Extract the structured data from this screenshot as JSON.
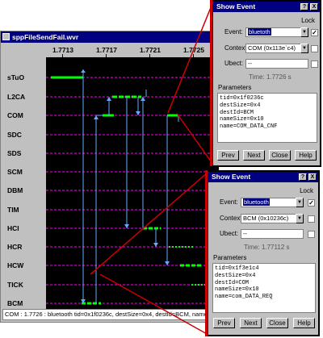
{
  "main_window": {
    "title": "sppFileSendFail.wvr",
    "time_ticks": [
      "1.7713",
      "1.7717",
      "1.7721",
      "1.7725"
    ],
    "rows": [
      "sTuO",
      "L2CA",
      "COM",
      "SDC",
      "SDS",
      "SCM",
      "DBM",
      "TIM",
      "HCI",
      "HCR",
      "HCW",
      "TICK",
      "BCM"
    ],
    "status_text": "COM : 1.7726 : bluetooth tid=0x1f0236c, destSize=0x4, destId=BCM, nameSize=0x10, nai"
  },
  "dialog_top": {
    "title": "Show Event",
    "lock_label": "Lock",
    "event_label": "Event:",
    "event_value": "bluetoth",
    "context_label": "Context:",
    "context_value": "COM (0x113e`c4)",
    "ubect_label": "Ubect:",
    "ubect_value": "--",
    "time_label": "Time:",
    "time_value": "1.7726 s",
    "params_label": "Parameters",
    "params": [
      "tid=0x1f0236c",
      "destSize=0x4",
      "destId=BCM",
      "nameSize=0x10",
      "name=COM_DATA_CNF"
    ],
    "buttons": [
      "Prev",
      "Next",
      "Close",
      "Help"
    ]
  },
  "dialog_bottom": {
    "title": "Show Event",
    "lock_label": "Lock",
    "event_label": "Event:",
    "event_value": "bluetooth",
    "context_label": "Context:",
    "context_value": "BCM (0x10236c)",
    "ubect_label": "Ubect:",
    "ubect_value": "--",
    "time_label": "Time:",
    "time_value": "1.77112 s",
    "params_label": "Parameters",
    "params": [
      "tid=0x1f3e1c4",
      "destSize=0x4",
      "destId=COM",
      "nameSize=0x10",
      "name=com_DATA_REQ"
    ],
    "buttons": [
      "Prev",
      "Next",
      "Close",
      "Help"
    ]
  },
  "title_buttons": [
    "?",
    "X"
  ],
  "colors": {
    "title_bar": "#000080",
    "plot_bg": "#000000",
    "grid_line": "#ff00ff",
    "event_green": "#00ff00",
    "arrow_blue": "#66aaff",
    "callout_red": "#cc0000"
  }
}
